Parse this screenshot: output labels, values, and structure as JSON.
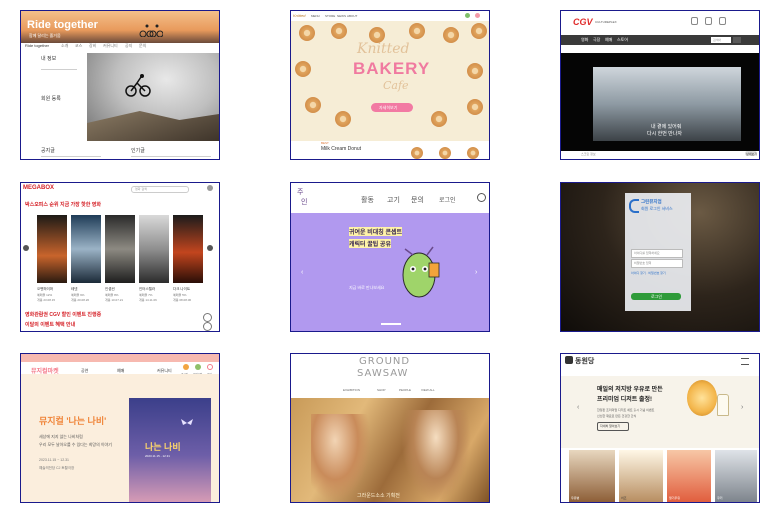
{
  "tiles": {
    "t1": {
      "title": "Ride together",
      "subtitle": "함께 달리는 즐거움",
      "menu": [
        "Ride together",
        "소개",
        "코스",
        "장비",
        "커뮤니티",
        "공지",
        "문의"
      ],
      "side_label_1": "내 정보",
      "side_label_2": "회원 등록",
      "footer_left": "공지글",
      "footer_right": "인기글"
    },
    "t2": {
      "nav_logo": "Knitted",
      "nav_links": [
        "MENU",
        "STORE",
        "NEWS",
        "ABOUT"
      ],
      "headline_top": "Knitted",
      "headline_main": "BAKERY",
      "headline_bottom": "Cafe",
      "cta": "자세히보기",
      "product_tag": "BEST",
      "product_title": "Milk Cream Donut"
    },
    "t3": {
      "logo": "CGV",
      "logo_sub": "CULTUREPLEX",
      "nav": [
        "영화",
        "극장",
        "예매",
        "스토어",
        "이벤트"
      ],
      "search_placeholder": "검색어",
      "caption_line1": "내 곁에 있어줘",
      "caption_line2": "다시 한번 만나자",
      "bottom_left": "스크린 정보",
      "bottom_right": "상세보기"
    },
    "t4": {
      "logo": "MEGABOX",
      "search_placeholder": "영화 검색",
      "section_title": "박스오피스 순위 지금 가장 핫한 영화",
      "movies": [
        {
          "title": "오펜하이머",
          "meta1": "예매율 12%",
          "meta2": "개봉 23.08.15"
        },
        {
          "title": "테넷",
          "meta1": "예매율 9%",
          "meta2": "개봉 20.08.26"
        },
        {
          "title": "인셉션",
          "meta1": "예매율 8%",
          "meta2": "개봉 10.07.21"
        },
        {
          "title": "인터스텔라",
          "meta1": "예매율 7%",
          "meta2": "개봉 14.11.06"
        },
        {
          "title": "다크 나이트",
          "meta1": "예매율 5%",
          "meta2": "개봉 08.08.06"
        }
      ],
      "notice1": "영화관람권 CGV 할인 이벤트 진행중",
      "notice2": "이달의 이벤트 혜택 안내"
    },
    "t5": {
      "logo_line1": "주",
      "logo_line2": "인",
      "nav": [
        "활동",
        "고기",
        "문의"
      ],
      "login": "로그인",
      "banner_text1": "귀여운 비대칭 콘셉트",
      "banner_text2": "캐릭터 꿀팁 공유",
      "banner_text3": "지금 바로 만나보세요"
    },
    "t6": {
      "brand_line1": "그린뮤지엄",
      "brand_line2": "회원 로그인 서비스",
      "id_placeholder": "아이디를 입력하세요",
      "pw_placeholder": "비밀번호 입력",
      "find_text": "아이디 찾기 · 비밀번호 찾기",
      "login_button": "로그인"
    },
    "t7": {
      "logo": "뮤지컬마켓",
      "nav": [
        "공연",
        "예매",
        "커뮤니티"
      ],
      "icons": [
        "로그인",
        "회원가입",
        "마이"
      ],
      "headline": "뮤지컬 '나는 나비'",
      "desc1": "세상에 지지 않는 나비처럼",
      "desc2": "우리 모두 날아오를 수 있다는 희망의 이야기",
      "date": "2023.11.15 ~ 12.31",
      "place": "예술의전당 CJ 토월극장",
      "poster_title": "나는 나비",
      "poster_sub": "2023.11.15 - 12.31"
    },
    "t8": {
      "logo_line1": "GROUND",
      "logo_line2": "SAWSAW",
      "nav": [
        "EXHIBITION",
        "SHOP",
        "PEOPLE",
        "VIEW ALL"
      ],
      "caption": "그라운드소소 기획전"
    },
    "t9": {
      "logo": "동원당",
      "headline1": "매일의 저지방 우유로 만든",
      "headline2": "프리미엄 디저트 출정!",
      "sub1": "한정판 프리미엄 디저트 세트 출시 기념 이벤트",
      "sub2": "신선한 재료로 만든 건강한 간식",
      "button": "자세히 알아보기",
      "products": [
        "우유병",
        "치즈",
        "딸기우유",
        "쿠키"
      ]
    }
  },
  "colors": {
    "frame": "#1a1a8c",
    "megabox_red": "#d52027",
    "purple": "#b199ef",
    "green_btn": "#2f9b3a",
    "pink": "#f47a8a"
  }
}
